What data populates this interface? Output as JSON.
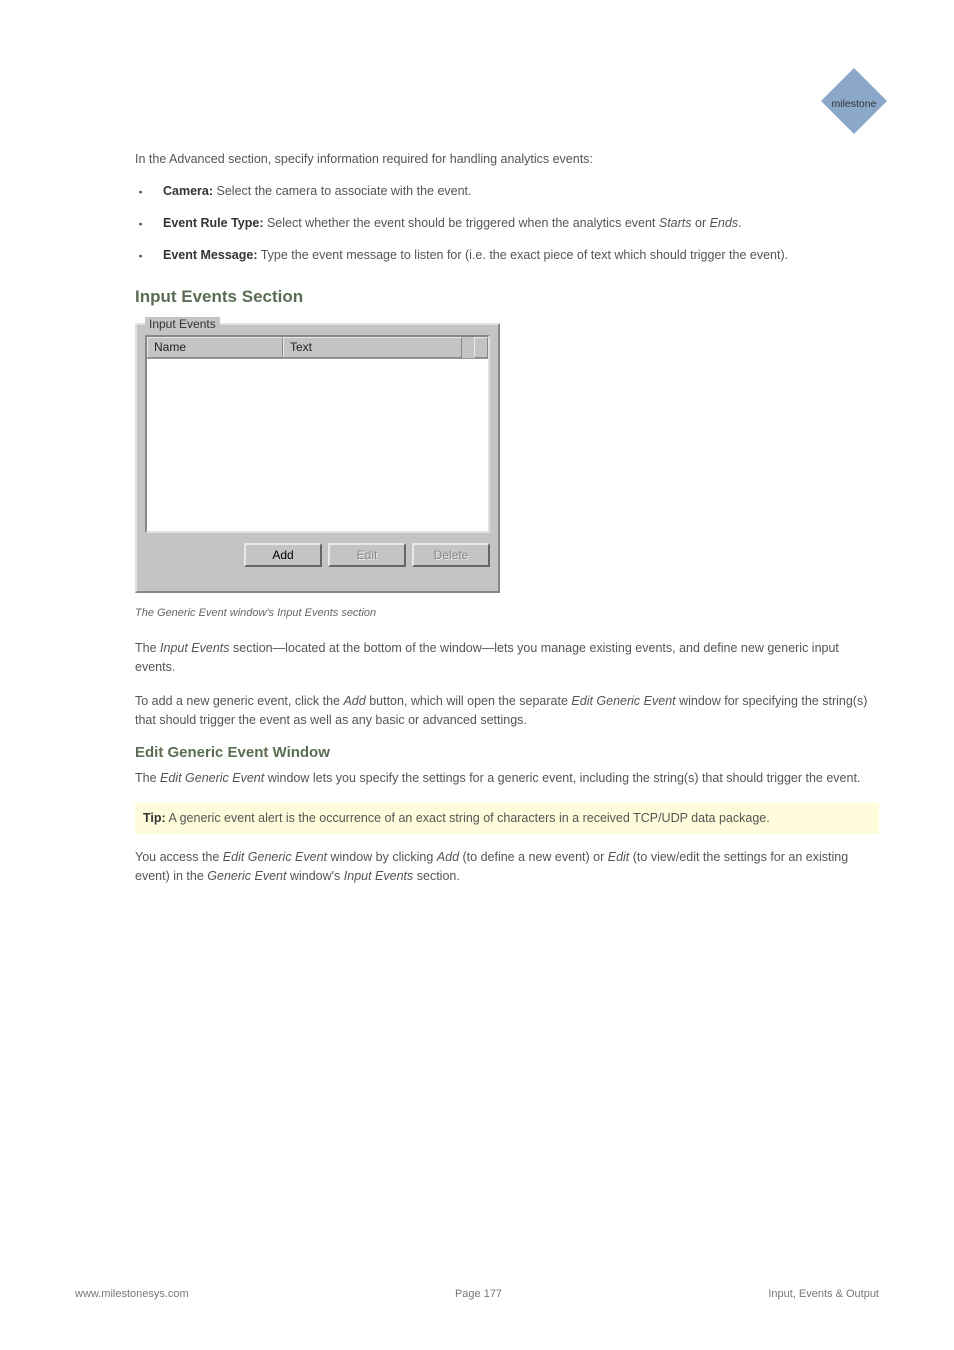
{
  "logo_text": "milestone",
  "intro": "In the Advanced section, specify information required for handling analytics events:",
  "bullets": [
    {
      "bold": "Camera:",
      "text": " Select the camera to associate with the event."
    },
    {
      "bold": "Event Rule Type:",
      "text": " Select whether the event should be triggered when the analytics event ",
      "italic": "Starts",
      "text2": " or ",
      "italic2": "Ends",
      "text3": "."
    },
    {
      "bold": "Event Message:",
      "text": " Type the event message to listen for (i.e. the exact piece of text which should trigger the event)."
    }
  ],
  "section_title": "Input Events Section",
  "fieldset": {
    "legend": "Input Events",
    "col_name": "Name",
    "col_text": "Text",
    "btn_add": "Add",
    "btn_edit": "Edit",
    "btn_delete": "Delete"
  },
  "caption": "The Generic Event window's Input Events section",
  "para1_part1": "The ",
  "para1_italic": "Input Events",
  "para1_part2": " section—located at the bottom of the window—lets you manage existing events, and define new generic input events.",
  "para2_part1": "To add a new generic event, click the ",
  "para2_italic": "Add",
  "para2_part2": " button, which will open the separate ",
  "para2_italic2": "Edit Generic Event",
  "para2_part3": " window for specifying the string(s) that should trigger the event as well as any basic or advanced settings.",
  "subsection_title": "Edit Generic Event Window",
  "sub_para1": "The ",
  "sub_para1_italic": "Edit Generic Event",
  "sub_para1_rest": " window lets you specify the settings for a generic event, including the string(s) that should trigger the event.",
  "tip": {
    "bold": "Tip:",
    "text": " A generic event alert is the occurrence of an exact string of characters in a received TCP/UDP data package."
  },
  "para3_part1": "You access the ",
  "para3_italic": "Edit Generic Event",
  "para3_part2": " window by clicking ",
  "para3_italic2": "Add",
  "para3_part3": " (to define a new event) or ",
  "para3_italic3": "Edit",
  "para3_part4": " (to view/edit the settings for an existing event) in the ",
  "para3_italic4": "Generic Event",
  "para3_part5": " window's ",
  "para3_italic5": "Input Events",
  "para3_part6": " section.",
  "footer": {
    "left": "www.milestonesys.com",
    "center": "Page 177",
    "right": "Input, Events & Output"
  }
}
